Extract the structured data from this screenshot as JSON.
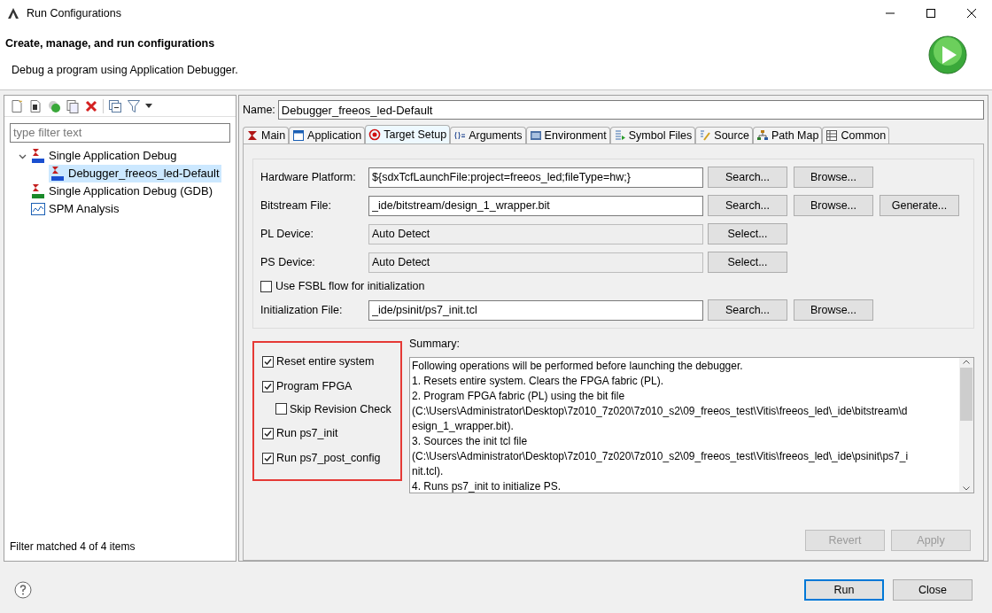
{
  "window": {
    "title": "Run Configurations"
  },
  "header": {
    "title": "Create, manage, and run configurations",
    "subtitle": "Debug a program using Application Debugger."
  },
  "sidebar": {
    "filter_placeholder": "type filter text",
    "tree": [
      {
        "label": "Single Application Debug",
        "kind": "tcf",
        "expanded": true,
        "selected": false,
        "children": [
          {
            "label": "Debugger_freeos_led-Default",
            "kind": "tcf",
            "selected": true
          }
        ]
      },
      {
        "label": "Single Application Debug (GDB)",
        "kind": "gdb",
        "selected": false
      },
      {
        "label": "SPM Analysis",
        "kind": "spm",
        "selected": false
      }
    ],
    "status": "Filter matched 4 of 4 items"
  },
  "name": {
    "label": "Name:",
    "value": "Debugger_freeos_led-Default"
  },
  "tabs": [
    {
      "label": "Main",
      "selected": false
    },
    {
      "label": "Application",
      "selected": false
    },
    {
      "label": "Target Setup",
      "selected": true
    },
    {
      "label": "Arguments",
      "selected": false
    },
    {
      "label": "Environment",
      "selected": false
    },
    {
      "label": "Symbol Files",
      "selected": false
    },
    {
      "label": "Source",
      "selected": false
    },
    {
      "label": "Path Map",
      "selected": false
    },
    {
      "label": "Common",
      "selected": false
    }
  ],
  "target_rows": [
    {
      "kind": "field",
      "label": "Hardware Platform:",
      "value": "${sdxTcfLaunchFile:project=freeos_led;fileType=hw;}",
      "disabled": false,
      "buttons": [
        "Search...",
        "Browse..."
      ]
    },
    {
      "kind": "field",
      "label": "Bitstream File:",
      "value": "_ide/bitstream/design_1_wrapper.bit",
      "disabled": false,
      "buttons": [
        "Search...",
        "Browse...",
        "Generate..."
      ]
    },
    {
      "kind": "field",
      "label": "PL Device:",
      "value": "Auto Detect",
      "disabled": true,
      "buttons": [
        "Select..."
      ]
    },
    {
      "kind": "field",
      "label": "PS Device:",
      "value": "Auto Detect",
      "disabled": true,
      "buttons": [
        "Select..."
      ]
    },
    {
      "kind": "checkbox",
      "label": "Use FSBL flow for initialization",
      "checked": false
    },
    {
      "kind": "field",
      "label": "Initialization File:",
      "value": "_ide/psinit/ps7_init.tcl",
      "disabled": false,
      "buttons": [
        "Search...",
        "Browse..."
      ]
    }
  ],
  "options": [
    {
      "label": "Reset entire system",
      "checked": true
    },
    {
      "label": "Program FPGA",
      "checked": true,
      "children": [
        {
          "label": "Skip Revision Check",
          "checked": false
        }
      ]
    },
    {
      "label": "Run ps7_init",
      "checked": true
    },
    {
      "label": "Run ps7_post_config",
      "checked": true
    }
  ],
  "summary": {
    "label": "Summary:",
    "lines": [
      "Following operations will be performed before launching the debugger.",
      "1. Resets entire system. Clears the FPGA fabric (PL).",
      "2. Program FPGA fabric (PL) using the bit file",
      "(C:\\Users\\Administrator\\Desktop\\7z010_7z020\\7z010_s2\\09_freeos_test\\Vitis\\freeos_led\\_ide\\bitstream\\d",
      "esign_1_wrapper.bit).",
      "3. Sources the init tcl file",
      "(C:\\Users\\Administrator\\Desktop\\7z010_7z020\\7z010_s2\\09_freeos_test\\Vitis\\freeos_led\\_ide\\psinit\\ps7_i",
      "nit.tcl).",
      "4. Runs ps7_init to initialize PS."
    ]
  },
  "apply_buttons": [
    {
      "label": "Revert",
      "disabled": true
    },
    {
      "label": "Apply",
      "disabled": true
    }
  ],
  "footer_buttons": [
    {
      "label": "Run",
      "default": true
    },
    {
      "label": "Close",
      "default": false
    }
  ]
}
